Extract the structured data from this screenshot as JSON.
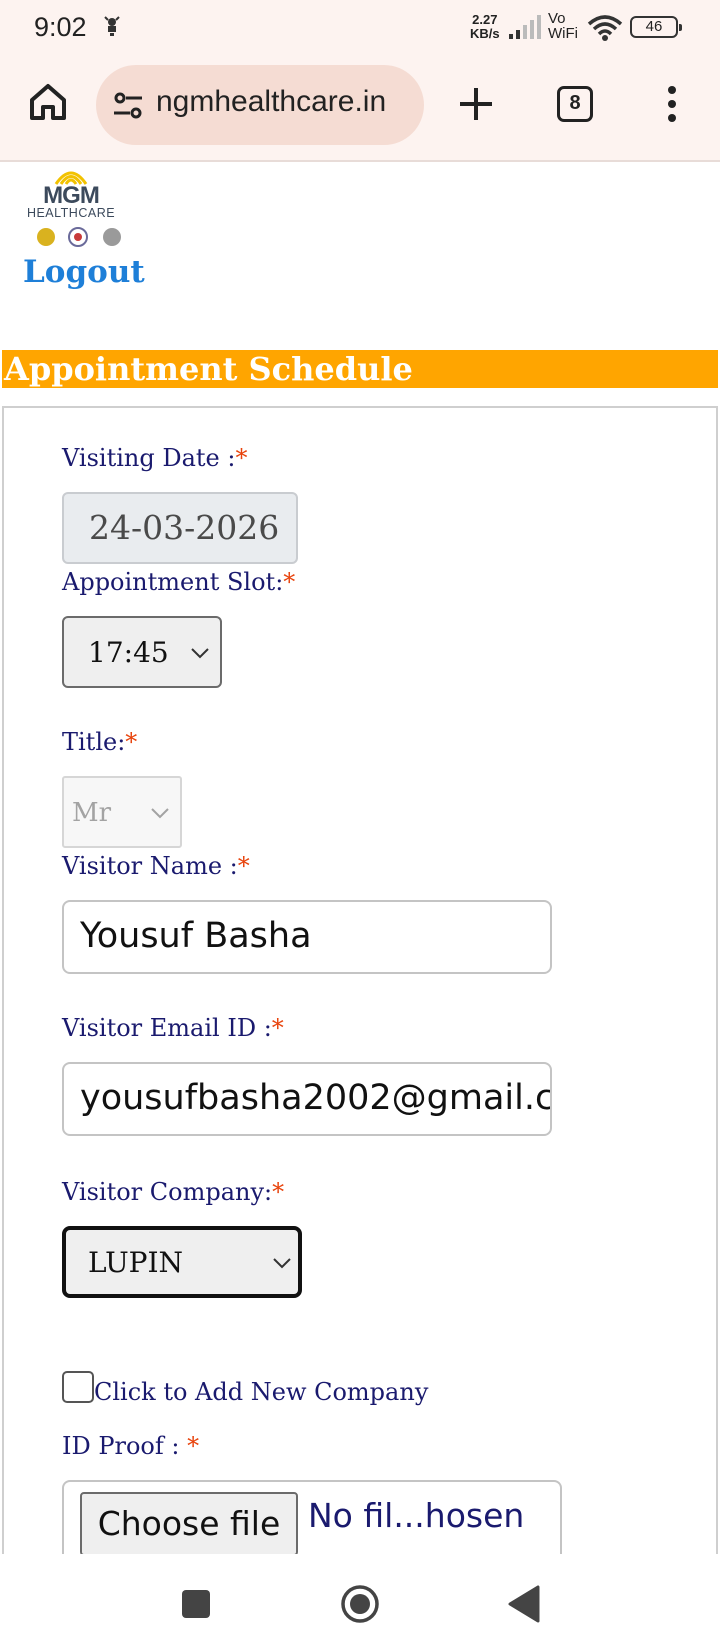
{
  "status_bar": {
    "time": "9:02",
    "speed_value": "2.27",
    "speed_unit": "KB/s",
    "vo": "Vo",
    "wifi": "WiFi",
    "battery": "46"
  },
  "browser": {
    "url": "ngmhealthcare.in",
    "tab_count": "8",
    "icons": [
      "home-icon",
      "site-settings-icon",
      "new-tab-icon",
      "tabs-icon",
      "more-menu-icon"
    ]
  },
  "header": {
    "logo_title": "MGM",
    "logo_subtitle": "HEALTHCARE",
    "logout_label": "Logout"
  },
  "section": {
    "title": "Appointment Schedule",
    "accent_color": "#ffa500"
  },
  "form": {
    "visiting_date": {
      "label": "Visiting Date :",
      "required": "*",
      "value": "24-03-2026"
    },
    "appointment_slot": {
      "label": "Appointment Slot:",
      "required": "*",
      "value": "17:45"
    },
    "title": {
      "label": "Title:",
      "required": "*",
      "value": "Mr"
    },
    "visitor_name": {
      "label": "Visitor Name :",
      "required": "*",
      "value": "Yousuf Basha"
    },
    "visitor_email": {
      "label": "Visitor Email ID :",
      "required": "*",
      "value": "yousufbasha2002@gmail.c"
    },
    "visitor_company": {
      "label": "Visitor Company:",
      "required": "*",
      "value": "LUPIN"
    },
    "add_company": {
      "label": "Click to Add New Company",
      "checked": false
    },
    "id_proof": {
      "label": "ID Proof : ",
      "required": "*",
      "button_label": "Choose file",
      "status": "No fil...hosen"
    }
  },
  "nav_bar": {
    "icons": [
      "recents-icon",
      "home-circle-icon",
      "back-icon"
    ]
  }
}
